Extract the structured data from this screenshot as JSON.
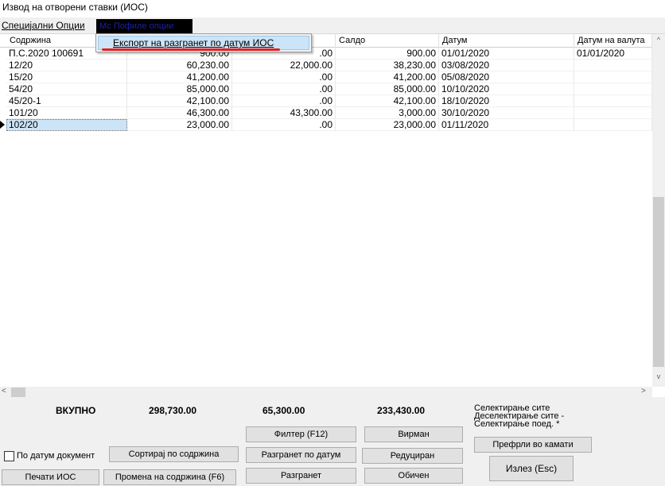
{
  "window": {
    "title": "Извод на отворени ставки (ИОС)"
  },
  "menu": {
    "items": [
      "Специјални Опции",
      "Мс Пофиле опции"
    ],
    "dropdown_item": "Експорт на разгранет по датум ИОС"
  },
  "grid": {
    "columns": [
      "Содржина",
      "",
      "",
      "Салдо",
      "Датум",
      "Датум на валута"
    ],
    "rows": [
      [
        "П.С.2020 100691",
        "900.00",
        ".00",
        "900.00",
        "01/01/2020",
        "01/01/2020"
      ],
      [
        "12/20",
        "60,230.00",
        "22,000.00",
        "38,230.00",
        "03/08/2020",
        ""
      ],
      [
        "15/20",
        "41,200.00",
        ".00",
        "41,200.00",
        "05/08/2020",
        ""
      ],
      [
        "54/20",
        "85,000.00",
        ".00",
        "85,000.00",
        "10/10/2020",
        ""
      ],
      [
        "45/20-1",
        "42,100.00",
        ".00",
        "42,100.00",
        "18/10/2020",
        ""
      ],
      [
        "101/20",
        "46,300.00",
        "43,300.00",
        "3,000.00",
        "30/10/2020",
        ""
      ],
      [
        "102/20",
        "23,000.00",
        ".00",
        "23,000.00",
        "01/11/2020",
        ""
      ]
    ],
    "selected_row": 6
  },
  "scroll": {
    "up": "^",
    "down": "v",
    "left": "<",
    "right": ">"
  },
  "footer": {
    "total_label": "ВКУПНО",
    "total_1": "298,730.00",
    "total_2": "65,300.00",
    "total_3": "233,430.00",
    "select_all": "Селектирање сите",
    "deselect_all": "Деселектирање сите -",
    "select_each": "Селектирање поед. *",
    "checkbox_label": "По датум документ",
    "buttons": {
      "filter": "Филтер (F12)",
      "virman": "Вирман",
      "transfer_interest": "Префрли во камати",
      "sort_content": "Сортирај по содржина",
      "branched_by_date": "Разгранет по датум",
      "reduced": "Редуциран",
      "exit": "Излез (Esc)",
      "print_ios": "Печати ИОС",
      "change_content": "Промена на содржина (F6)",
      "branched": "Разгранет",
      "normal": "Обичен"
    }
  }
}
